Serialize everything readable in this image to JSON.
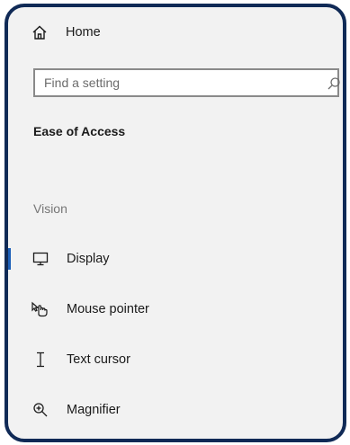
{
  "nav": {
    "home_label": "Home",
    "home_icon": "home-icon"
  },
  "search": {
    "placeholder": "Find a setting",
    "value": "",
    "icon": "search-icon"
  },
  "section": {
    "title": "Ease of Access"
  },
  "vision": {
    "group_label": "Vision",
    "items": [
      {
        "label": "Display",
        "icon": "display-icon",
        "selected": true
      },
      {
        "label": "Mouse pointer",
        "icon": "mouse-pointer-icon",
        "selected": false
      },
      {
        "label": "Text cursor",
        "icon": "text-cursor-icon",
        "selected": false
      },
      {
        "label": "Magnifier",
        "icon": "magnifier-icon",
        "selected": false
      }
    ]
  },
  "colors": {
    "frame_border": "#102a56",
    "panel_background": "#f2f2f2",
    "accent": "#1c5fb8",
    "muted_text": "#767676"
  }
}
